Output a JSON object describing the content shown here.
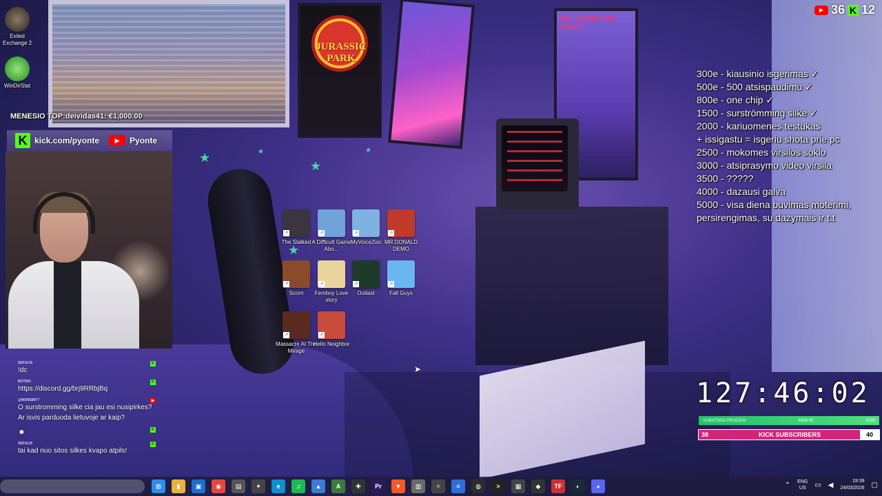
{
  "desktop_shortcuts_left": [
    {
      "label": "Exiled Exchange 2",
      "color": "#5c5246"
    },
    {
      "label": "WinDirStat",
      "color": "#3fa63a"
    }
  ],
  "overlay": {
    "monthly_top": "MENESIO TOP:deividas41: €1,000.00",
    "kick_handle": "kick.com/pyonte",
    "yt_handle": "Pyonte"
  },
  "desktop_icons": [
    {
      "label": "The Stalked",
      "color": "#3a3540"
    },
    {
      "label": "A Difficult Game Abo...",
      "color": "#6fa3d9"
    },
    {
      "label": "MyVoiceZoo",
      "color": "#7fb2e0"
    },
    {
      "label": "MR DONALD DEMO",
      "color": "#c0392b"
    },
    {
      "label": "Scorn",
      "color": "#8a4b2a"
    },
    {
      "label": "Femboy Love story",
      "color": "#e9d59b"
    },
    {
      "label": "Outlast",
      "color": "#1e3b2a"
    },
    {
      "label": "Fall Guys",
      "color": "#6ab6f0"
    },
    {
      "label": "Massacre At The Mirage",
      "color": "#5a2a20"
    },
    {
      "label": "Hello Neighbor",
      "color": "#c94b3a"
    }
  ],
  "goals": [
    "300e - kiausinio isgerimas ✓",
    "500e - 500 atsispaudimu ✓",
    "800e - one chip ✓",
    "1500 - surströmming silke ✓",
    "2000 - kariuomenes testukas",
    "+ issigastu = isgeriu shota prie pc",
    "2500 - mokomes virsilos sokio",
    "3000 - atsiprasymo video virsila",
    "3500 - ?????",
    "4000 - dazausi galva",
    "5000 - visa diena buvimas moterimi,",
    "persirengimas, su dazymais ir t.t"
  ],
  "top_badge": {
    "yt_count": "36",
    "kick_count": "12"
  },
  "timer": {
    "value": "127:46:02",
    "bar_left": "SUBATONO PRADZIAI",
    "bar_mid": "€686.00",
    "bar_right": "€200",
    "subs_left": "38",
    "subs_label": "KICK SUBSCRIBERS",
    "subs_right": "40"
  },
  "chat": [
    {
      "user": "SEFULIS",
      "text": "!dc",
      "badge": "kick"
    },
    {
      "user": "BOTRIX",
      "text": "https://discord.gg/brj9RRbjBq",
      "badge": "kick"
    },
    {
      "user": "@MONS8977",
      "text": "O surstromming silke cia jau esi nusipirkes? Ar isvis parduoda lietuvoje ar kaip?",
      "badge": "yt"
    },
    {
      "user": "",
      "text": "☻",
      "badge": "kick"
    },
    {
      "user": "SEFULIS",
      "text": "tai kad nuo sitos silkes kvapo atpils!",
      "badge": "kick"
    }
  ],
  "taskbar": {
    "apps": [
      {
        "name": "windows",
        "color": "#2d8cf0",
        "glyph": "⊞"
      },
      {
        "name": "files",
        "color": "#e8b33a",
        "glyph": "▮"
      },
      {
        "name": "store",
        "color": "#1a6fd1",
        "glyph": "▣"
      },
      {
        "name": "chrome",
        "color": "#e8453c",
        "glyph": "◉"
      },
      {
        "name": "app",
        "color": "#555",
        "glyph": "▤"
      },
      {
        "name": "app2",
        "color": "#444",
        "glyph": "✦"
      },
      {
        "name": "edge",
        "color": "#0f8fce",
        "glyph": "e"
      },
      {
        "name": "spotify",
        "color": "#1db954",
        "glyph": "♫"
      },
      {
        "name": "photos",
        "color": "#3a7bd5",
        "glyph": "▲"
      },
      {
        "name": "game",
        "color": "#3b7a3b",
        "glyph": "A"
      },
      {
        "name": "app3",
        "color": "#333",
        "glyph": "✚"
      },
      {
        "name": "premiere",
        "color": "#2b1a5a",
        "glyph": "Pr"
      },
      {
        "name": "brave",
        "color": "#f05a28",
        "glyph": "▼"
      },
      {
        "name": "app4",
        "color": "#6a6a6a",
        "glyph": "▥"
      },
      {
        "name": "app5",
        "color": "#444",
        "glyph": "✧"
      },
      {
        "name": "notepad",
        "color": "#2f6fd6",
        "glyph": "≡"
      },
      {
        "name": "obs",
        "color": "#2c2c2c",
        "glyph": "◍"
      },
      {
        "name": "terminal",
        "color": "#222",
        "glyph": ">"
      },
      {
        "name": "app6",
        "color": "#444",
        "glyph": "▦"
      },
      {
        "name": "app7",
        "color": "#333",
        "glyph": "◆"
      },
      {
        "name": "tf",
        "color": "#c83232",
        "glyph": "TF"
      },
      {
        "name": "steam",
        "color": "#1b2838",
        "glyph": "◐"
      },
      {
        "name": "discord",
        "color": "#5865f2",
        "glyph": "◕"
      }
    ],
    "lang": "ENG",
    "region": "US",
    "time": "19:39",
    "date": "24/03/2026"
  }
}
